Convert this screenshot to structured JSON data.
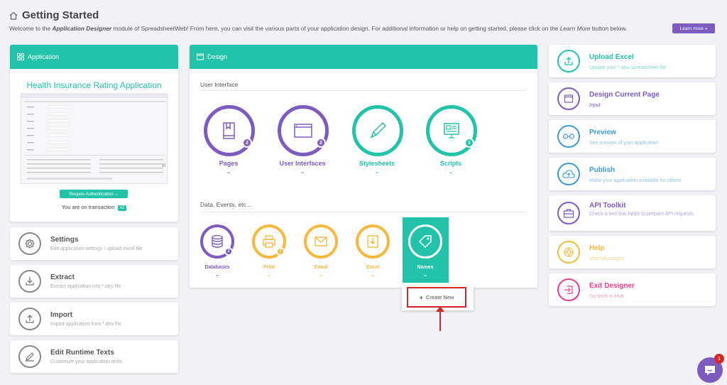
{
  "header": {
    "title": "Getting Started",
    "welcome_pre": "Welcome to the",
    "welcome_bold": "Application Designer",
    "welcome_mid": "module of SpreadsheetWeb! From here, you can visit the various parts of your application design. For additional information or help on getting started, please click on the",
    "welcome_italic": "Learn More",
    "welcome_post": "button below.",
    "learn_more": "Learn more »"
  },
  "application": {
    "header": "Application",
    "title": "Health Insurance Rating Application",
    "require_auth": "Require Authentication ⌄",
    "transaction_text": "You are on transaction",
    "transaction_badge": "#2"
  },
  "left_cards": [
    {
      "title": "Settings",
      "subtitle": "Edit application settings / upload excel file",
      "icon": "gear-icon"
    },
    {
      "title": "Extract",
      "subtitle": "Extract application into *.des file",
      "icon": "download-icon"
    },
    {
      "title": "Import",
      "subtitle": "Import application from *.des file",
      "icon": "upload-icon"
    },
    {
      "title": "Edit Runtime Texts",
      "subtitle": "Customize your application texts",
      "icon": "edit-icon"
    }
  ],
  "design": {
    "header": "Design",
    "ui_section": "User Interface",
    "data_section": "Data, Events, etc...",
    "ui_items": [
      {
        "label": "Pages",
        "badge": "2",
        "color": "#7c5cbf"
      },
      {
        "label": "User Interfaces",
        "badge": "2",
        "color": "#7c5cbf"
      },
      {
        "label": "Stylesheets",
        "badge": "",
        "color": "#22c3a8"
      },
      {
        "label": "Scripts",
        "badge": "1",
        "color": "#22c3a8"
      }
    ],
    "data_items": [
      {
        "label": "Databases",
        "badge": "2",
        "color": "#7c5cbf"
      },
      {
        "label": "Print",
        "badge": "1",
        "color": "#f5b93e"
      },
      {
        "label": "Email",
        "badge": "",
        "color": "#f5b93e"
      },
      {
        "label": "Excel",
        "badge": "",
        "color": "#f5b93e"
      },
      {
        "label": "Names",
        "badge": "",
        "color": "#22c3a8"
      }
    ],
    "create_new": "Create New"
  },
  "right_cards": [
    {
      "title": "Upload Excel",
      "subtitle": "Update your *.xlsx spreadsheet file",
      "color": "#22c3a8",
      "icon": "upload-excel-icon"
    },
    {
      "title": "Design Current Page",
      "subtitle": "Input",
      "color": "#7c5cbf",
      "icon": "window-icon"
    },
    {
      "title": "Preview",
      "subtitle": "See preview of your application",
      "color": "#3b9ad9",
      "icon": "glasses-icon"
    },
    {
      "title": "Publish",
      "subtitle": "Make your application available for others",
      "color": "#3b9ad9",
      "icon": "cloud-upload-icon"
    },
    {
      "title": "API Toolkit",
      "subtitle": "Check a tool that helps to prepare API requests",
      "color": "#7c5cbf",
      "icon": "briefcase-icon"
    },
    {
      "title": "Help",
      "subtitle": "Visit help pages",
      "color": "#f5b93e",
      "icon": "lifebuoy-icon"
    },
    {
      "title": "Exit Designer",
      "subtitle": "Go back to Hub",
      "color": "#e83e8c",
      "icon": "exit-icon"
    }
  ],
  "chat": {
    "badge": "1"
  }
}
